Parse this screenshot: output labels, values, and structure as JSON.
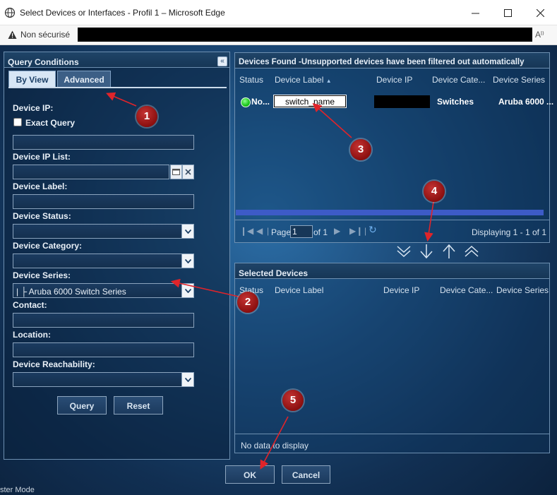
{
  "window": {
    "title": "Select Devices or Interfaces - Profil 1 – Microsoft Edge",
    "insecure_label": "Non sécurisé",
    "read_aloud": "Aˡ⁾"
  },
  "query": {
    "panel_title": "Query Conditions",
    "collapse_glyph": "«",
    "tabs": [
      {
        "label": "By View",
        "active": true
      },
      {
        "label": "Advanced",
        "active": false
      }
    ],
    "device_ip_label": "Device IP:",
    "exact_query_label": "Exact Query",
    "device_ip_list_label": "Device IP List:",
    "device_label_label": "Device Label:",
    "device_status_label": "Device Status:",
    "device_category_label": "Device Category:",
    "device_series_label": "Device Series:",
    "device_series_value": "|      ├ Aruba 6000 Switch Series",
    "contact_label": "Contact:",
    "location_label": "Location:",
    "reachability_label": "Device Reachability:",
    "query_button": "Query",
    "reset_button": "Reset"
  },
  "found": {
    "panel_title": "Devices Found -Unsupported devices have been filtered out automatically",
    "columns": [
      "Status",
      "Device Label",
      "Device IP",
      "Device Cate...",
      "Device Series"
    ],
    "rows": [
      {
        "status": "No...",
        "label": "switch_name",
        "ip": "",
        "category": "Switches",
        "series": "Aruba 6000 ..."
      }
    ],
    "pager": {
      "page_prefix": "Page",
      "page_value": "1",
      "of_text": "of 1",
      "displaying": "Displaying 1 - 1 of 1"
    }
  },
  "selected": {
    "panel_title": "Selected Devices",
    "columns": [
      "Status",
      "Device Label",
      "Device IP",
      "Device Cate...",
      "Device Series"
    ],
    "empty_text": "No data to display"
  },
  "footer": {
    "ok_button": "OK",
    "cancel_button": "Cancel"
  },
  "background_hint": "ster Mode",
  "annotations": [
    "1",
    "2",
    "3",
    "4",
    "5"
  ],
  "colors": {
    "accent_red": "#8b0f0f",
    "status_green": "#19c419",
    "progress_blue": "#3d5bc7"
  }
}
